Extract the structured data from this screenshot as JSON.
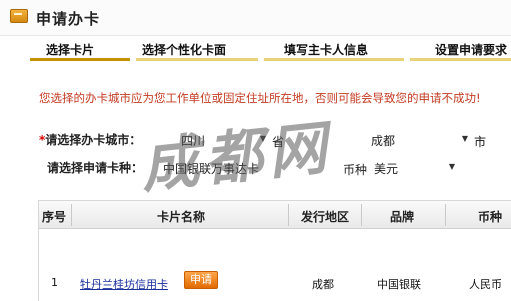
{
  "header": {
    "title": "申请办卡",
    "logo_icon": "card-icon"
  },
  "steps": [
    {
      "label": "选择卡片",
      "active": true
    },
    {
      "label": "选择个性化卡面",
      "active": false
    },
    {
      "label": "填写主卡人信息",
      "active": false
    },
    {
      "label": "设置申请要求",
      "active": false
    }
  ],
  "notice": "您选择的办卡城市应为您工作单位或固定住址所在地，否则可能会导致您的申请不成功!",
  "form": {
    "city_label_required": "*",
    "city_label": "请选择办卡城市：",
    "province_value": "四川",
    "province_suffix": "省",
    "city_value": "成都",
    "city_suffix": "市",
    "card_label": "请选择申请卡种：",
    "card_type_value": "中国银联万事达卡",
    "currency_label": "币种",
    "currency_value": "美元"
  },
  "table": {
    "headers": [
      "序号",
      "卡片名称",
      "发行地区",
      "品牌",
      "币种"
    ],
    "rows": [
      {
        "index": "1",
        "card_name": "牡丹兰桂坊信用卡",
        "apply_label": "申请",
        "region": "成都",
        "brand": "中国银联",
        "currency": "人民币"
      }
    ]
  },
  "watermark": "成都网",
  "colors": {
    "notice": "#c23b22",
    "active_step": "#c69200",
    "apply_button": "#f08a1c",
    "link": "#1a2f9c"
  }
}
